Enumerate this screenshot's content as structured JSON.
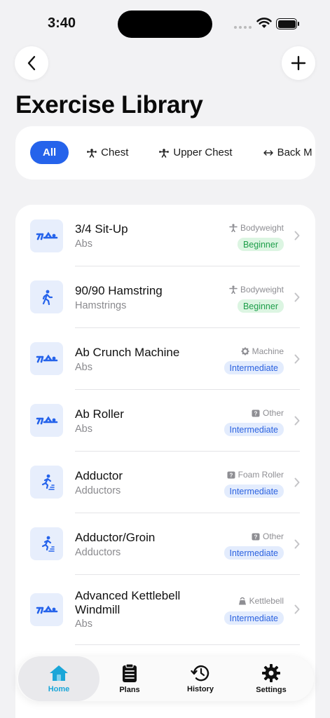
{
  "status": {
    "time": "3:40"
  },
  "page": {
    "title": "Exercise Library"
  },
  "filters": [
    {
      "label": "All",
      "icon": ""
    },
    {
      "label": "Chest",
      "icon": "weightlifter-icon"
    },
    {
      "label": "Upper Chest",
      "icon": "weightlifter-icon"
    },
    {
      "label": "Back M",
      "icon": "arrows-horizontal-icon"
    }
  ],
  "exercises": [
    {
      "name": "3/4 Sit-Up",
      "muscle": "Abs",
      "equipment": "Bodyweight",
      "equipment_icon": "person-icon",
      "level": "Beginner",
      "thumb_icon": "situp-icon"
    },
    {
      "name": "90/90 Hamstring",
      "muscle": "Hamstrings",
      "equipment": "Bodyweight",
      "equipment_icon": "person-icon",
      "level": "Beginner",
      "thumb_icon": "walking-icon"
    },
    {
      "name": "Ab Crunch Machine",
      "muscle": "Abs",
      "equipment": "Machine",
      "equipment_icon": "gear-icon",
      "level": "Intermediate",
      "thumb_icon": "situp-icon"
    },
    {
      "name": "Ab Roller",
      "muscle": "Abs",
      "equipment": "Other",
      "equipment_icon": "question-box-icon",
      "level": "Intermediate",
      "thumb_icon": "situp-icon"
    },
    {
      "name": "Adductor",
      "muscle": "Adductors",
      "equipment": "Foam Roller",
      "equipment_icon": "question-box-icon",
      "level": "Intermediate",
      "thumb_icon": "stairs-icon"
    },
    {
      "name": "Adductor/Groin",
      "muscle": "Adductors",
      "equipment": "Other",
      "equipment_icon": "question-box-icon",
      "level": "Intermediate",
      "thumb_icon": "stairs-icon"
    },
    {
      "name": "Advanced Kettlebell Windmill",
      "muscle": "Abs",
      "equipment": "Kettlebell",
      "equipment_icon": "kettlebell-icon",
      "level": "Intermediate",
      "thumb_icon": "situp-icon"
    }
  ],
  "tabs": [
    {
      "label": "Home",
      "icon": "home-icon",
      "active": true
    },
    {
      "label": "Plans",
      "icon": "clipboard-icon",
      "active": false
    },
    {
      "label": "History",
      "icon": "history-icon",
      "active": false
    },
    {
      "label": "Settings",
      "icon": "gear-icon",
      "active": false
    }
  ],
  "colors": {
    "accent": "#2563eb",
    "beginner_bg": "#dcf5e2",
    "beginner_text": "#1e9e4a",
    "intermediate_bg": "#e3ecfd",
    "intermediate_text": "#2b62e0",
    "home_active": "#1aa6d8"
  }
}
